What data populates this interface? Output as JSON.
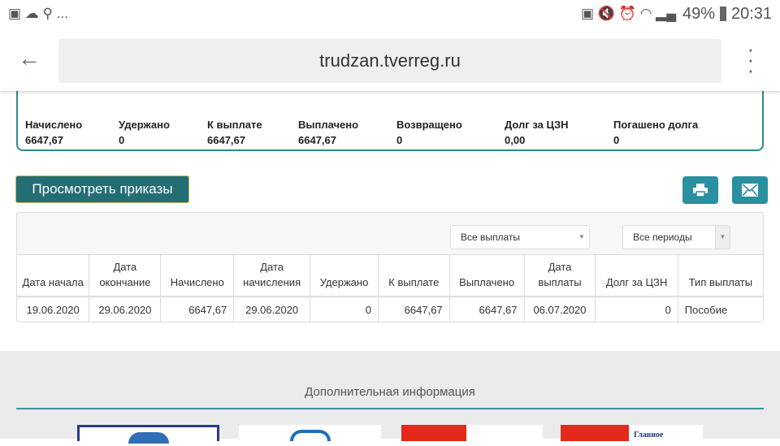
{
  "status_bar": {
    "battery": "49%",
    "time": "20:31",
    "dots": "..."
  },
  "browser": {
    "url": "trudzan.tverreg.ru"
  },
  "summary": {
    "items": [
      {
        "label": "Начислено",
        "value": "6647,67"
      },
      {
        "label": "Удержано",
        "value": "0"
      },
      {
        "label": "К выплате",
        "value": "6647,67"
      },
      {
        "label": "Выплачено",
        "value": "6647,67"
      },
      {
        "label": "Возвращено",
        "value": "0"
      },
      {
        "label": "Долг за ЦЗН",
        "value": "0,00"
      },
      {
        "label": "Погашено долга",
        "value": "0"
      }
    ]
  },
  "actions": {
    "orders_label": "Просмотреть приказы"
  },
  "filters": {
    "payments": "Все выплаты",
    "periods": "Все периоды"
  },
  "table": {
    "headers": [
      "Дата начала",
      "Дата окончание",
      "Начислено",
      "Дата начисления",
      "Удержано",
      "К выплате",
      "Выплачено",
      "Дата выплаты",
      "Долг за ЦЗН",
      "Тип выплаты"
    ],
    "rows": [
      [
        "19.06.2020",
        "29.06.2020",
        "6647,67",
        "29.06.2020",
        "0",
        "6647,67",
        "6647,67",
        "06.07.2020",
        "0",
        "Пособие"
      ]
    ]
  },
  "footer": {
    "title": "Дополнительная информация",
    "logo_text": "Главное"
  }
}
